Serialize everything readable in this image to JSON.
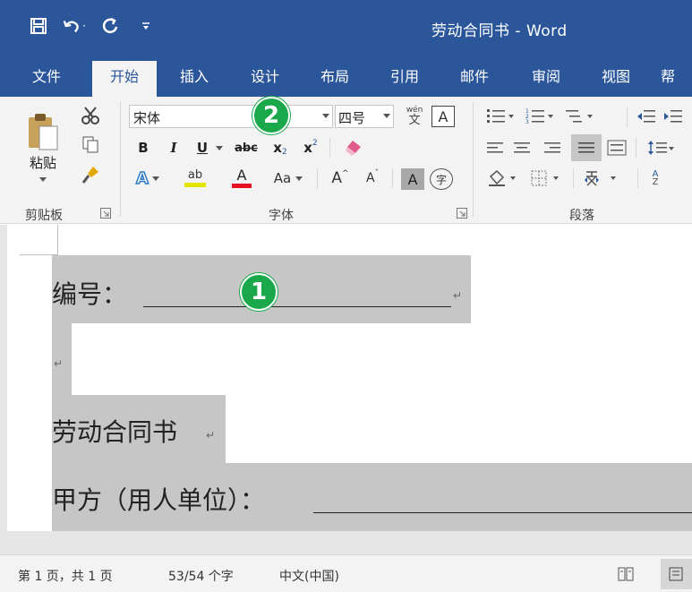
{
  "window": {
    "title": "劳动合同书 - Word"
  },
  "quick_access": {
    "save_icon": "save-icon",
    "undo_icon": "undo-icon",
    "redo_icon": "redo-icon",
    "customize_icon": "customize-icon",
    "undo_dropdown": "·"
  },
  "tabs": [
    {
      "label": "文件"
    },
    {
      "label": "开始"
    },
    {
      "label": "插入"
    },
    {
      "label": "设计"
    },
    {
      "label": "布局"
    },
    {
      "label": "引用"
    },
    {
      "label": "邮件"
    },
    {
      "label": "审阅"
    },
    {
      "label": "视图"
    },
    {
      "label": "帮"
    }
  ],
  "ribbon": {
    "clipboard": {
      "paste_label": "粘贴",
      "group_label": "剪贴板"
    },
    "font": {
      "font_name": "宋体",
      "font_size": "四号",
      "phonetic": "wén",
      "phonetic_char": "文",
      "border_char": "A",
      "bold": "B",
      "italic": "I",
      "underline": "U",
      "strike": "abc",
      "subscript": "x",
      "sub_mark": "2",
      "superscript": "x",
      "super_mark": "2",
      "case": "Aa",
      "grow": "A",
      "shrink": "A",
      "shade_char": "A",
      "enclose_char": "字",
      "highlight_char": "ab",
      "color_char": "A",
      "effect_char": "A",
      "group_label": "字体"
    },
    "paragraph": {
      "group_label": "段落",
      "sort_char": "A",
      "sort_char2": "Z"
    }
  },
  "badges": {
    "one": "1",
    "two": "2"
  },
  "document": {
    "line1": "编号：",
    "line3": "劳动合同书",
    "line4": "甲方（用人单位）：",
    "para_mark": "↵"
  },
  "status": {
    "page": "第 1 页，共 1 页",
    "words": "53/54 个字",
    "lang": "中文(中国)"
  },
  "colors": {
    "accent": "#2b579a",
    "badge": "#1aa84a",
    "highlight": "#e3e300",
    "font_red": "#e81123"
  }
}
